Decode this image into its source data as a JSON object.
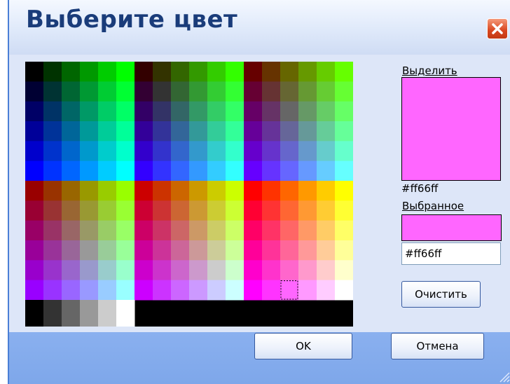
{
  "window": {
    "title": "Выберите цвет",
    "close_icon": "close-icon"
  },
  "highlight": {
    "label": "Выделить",
    "hex": "#ff66ff",
    "color": "#ff66ff"
  },
  "selected": {
    "label": "Выбранное",
    "hex": "#ff66ff",
    "color": "#ff66ff",
    "input_value": "#ff66ff"
  },
  "buttons": {
    "clear": "Очистить",
    "ok": "OK",
    "cancel": "Отмена"
  },
  "palette": {
    "levels": [
      "00",
      "33",
      "66",
      "99",
      "cc",
      "ff"
    ],
    "grays": [
      "#000000",
      "#333333",
      "#666666",
      "#999999",
      "#cccccc",
      "#ffffff"
    ],
    "selected_color": "#ff66ff"
  },
  "colors": {
    "title_text": "#1a3c7a",
    "dialog_bg": "#dde6f8",
    "footer_bg": "#7ea7ea",
    "close_bg": "#d8461e"
  }
}
